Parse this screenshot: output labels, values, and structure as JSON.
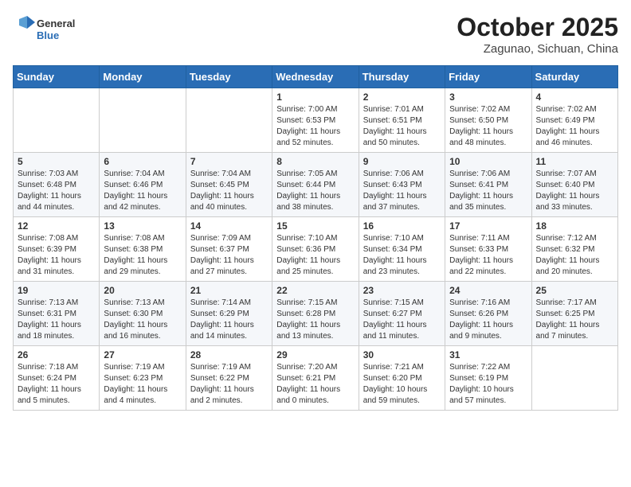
{
  "header": {
    "logo_general": "General",
    "logo_blue": "Blue",
    "month_title": "October 2025",
    "location": "Zagunao, Sichuan, China"
  },
  "days_of_week": [
    "Sunday",
    "Monday",
    "Tuesday",
    "Wednesday",
    "Thursday",
    "Friday",
    "Saturday"
  ],
  "weeks": [
    [
      {
        "day": "",
        "info": ""
      },
      {
        "day": "",
        "info": ""
      },
      {
        "day": "",
        "info": ""
      },
      {
        "day": "1",
        "info": "Sunrise: 7:00 AM\nSunset: 6:53 PM\nDaylight: 11 hours\nand 52 minutes."
      },
      {
        "day": "2",
        "info": "Sunrise: 7:01 AM\nSunset: 6:51 PM\nDaylight: 11 hours\nand 50 minutes."
      },
      {
        "day": "3",
        "info": "Sunrise: 7:02 AM\nSunset: 6:50 PM\nDaylight: 11 hours\nand 48 minutes."
      },
      {
        "day": "4",
        "info": "Sunrise: 7:02 AM\nSunset: 6:49 PM\nDaylight: 11 hours\nand 46 minutes."
      }
    ],
    [
      {
        "day": "5",
        "info": "Sunrise: 7:03 AM\nSunset: 6:48 PM\nDaylight: 11 hours\nand 44 minutes."
      },
      {
        "day": "6",
        "info": "Sunrise: 7:04 AM\nSunset: 6:46 PM\nDaylight: 11 hours\nand 42 minutes."
      },
      {
        "day": "7",
        "info": "Sunrise: 7:04 AM\nSunset: 6:45 PM\nDaylight: 11 hours\nand 40 minutes."
      },
      {
        "day": "8",
        "info": "Sunrise: 7:05 AM\nSunset: 6:44 PM\nDaylight: 11 hours\nand 38 minutes."
      },
      {
        "day": "9",
        "info": "Sunrise: 7:06 AM\nSunset: 6:43 PM\nDaylight: 11 hours\nand 37 minutes."
      },
      {
        "day": "10",
        "info": "Sunrise: 7:06 AM\nSunset: 6:41 PM\nDaylight: 11 hours\nand 35 minutes."
      },
      {
        "day": "11",
        "info": "Sunrise: 7:07 AM\nSunset: 6:40 PM\nDaylight: 11 hours\nand 33 minutes."
      }
    ],
    [
      {
        "day": "12",
        "info": "Sunrise: 7:08 AM\nSunset: 6:39 PM\nDaylight: 11 hours\nand 31 minutes."
      },
      {
        "day": "13",
        "info": "Sunrise: 7:08 AM\nSunset: 6:38 PM\nDaylight: 11 hours\nand 29 minutes."
      },
      {
        "day": "14",
        "info": "Sunrise: 7:09 AM\nSunset: 6:37 PM\nDaylight: 11 hours\nand 27 minutes."
      },
      {
        "day": "15",
        "info": "Sunrise: 7:10 AM\nSunset: 6:36 PM\nDaylight: 11 hours\nand 25 minutes."
      },
      {
        "day": "16",
        "info": "Sunrise: 7:10 AM\nSunset: 6:34 PM\nDaylight: 11 hours\nand 23 minutes."
      },
      {
        "day": "17",
        "info": "Sunrise: 7:11 AM\nSunset: 6:33 PM\nDaylight: 11 hours\nand 22 minutes."
      },
      {
        "day": "18",
        "info": "Sunrise: 7:12 AM\nSunset: 6:32 PM\nDaylight: 11 hours\nand 20 minutes."
      }
    ],
    [
      {
        "day": "19",
        "info": "Sunrise: 7:13 AM\nSunset: 6:31 PM\nDaylight: 11 hours\nand 18 minutes."
      },
      {
        "day": "20",
        "info": "Sunrise: 7:13 AM\nSunset: 6:30 PM\nDaylight: 11 hours\nand 16 minutes."
      },
      {
        "day": "21",
        "info": "Sunrise: 7:14 AM\nSunset: 6:29 PM\nDaylight: 11 hours\nand 14 minutes."
      },
      {
        "day": "22",
        "info": "Sunrise: 7:15 AM\nSunset: 6:28 PM\nDaylight: 11 hours\nand 13 minutes."
      },
      {
        "day": "23",
        "info": "Sunrise: 7:15 AM\nSunset: 6:27 PM\nDaylight: 11 hours\nand 11 minutes."
      },
      {
        "day": "24",
        "info": "Sunrise: 7:16 AM\nSunset: 6:26 PM\nDaylight: 11 hours\nand 9 minutes."
      },
      {
        "day": "25",
        "info": "Sunrise: 7:17 AM\nSunset: 6:25 PM\nDaylight: 11 hours\nand 7 minutes."
      }
    ],
    [
      {
        "day": "26",
        "info": "Sunrise: 7:18 AM\nSunset: 6:24 PM\nDaylight: 11 hours\nand 5 minutes."
      },
      {
        "day": "27",
        "info": "Sunrise: 7:19 AM\nSunset: 6:23 PM\nDaylight: 11 hours\nand 4 minutes."
      },
      {
        "day": "28",
        "info": "Sunrise: 7:19 AM\nSunset: 6:22 PM\nDaylight: 11 hours\nand 2 minutes."
      },
      {
        "day": "29",
        "info": "Sunrise: 7:20 AM\nSunset: 6:21 PM\nDaylight: 11 hours\nand 0 minutes."
      },
      {
        "day": "30",
        "info": "Sunrise: 7:21 AM\nSunset: 6:20 PM\nDaylight: 10 hours\nand 59 minutes."
      },
      {
        "day": "31",
        "info": "Sunrise: 7:22 AM\nSunset: 6:19 PM\nDaylight: 10 hours\nand 57 minutes."
      },
      {
        "day": "",
        "info": ""
      }
    ]
  ]
}
